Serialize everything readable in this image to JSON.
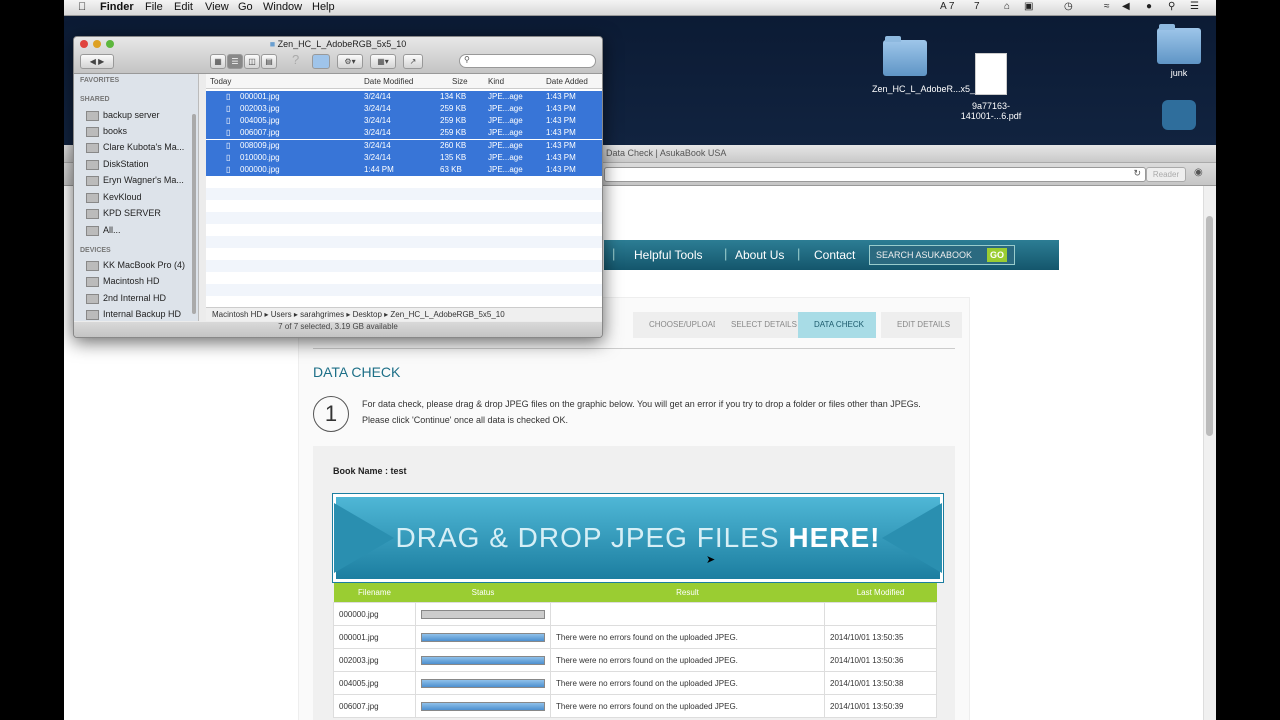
{
  "menubar": {
    "apple": "",
    "app": "Finder",
    "items": [
      "File",
      "Edit",
      "View",
      "Go",
      "Window",
      "Help"
    ],
    "status": [
      "A 7",
      "7"
    ]
  },
  "desktop": {
    "icons": [
      {
        "label": "Zen_HC_L_AdobeR...x5_10",
        "type": "folder-icon"
      },
      {
        "label": "9a77163-141001-...6.pdf",
        "type": "pdf-icon"
      },
      {
        "label": "junk",
        "type": "folder-icon"
      }
    ]
  },
  "browser": {
    "title": "Data Check | AsukaBook USA",
    "reader": "Reader",
    "nav": [
      "Helpful Tools",
      "About Us",
      "Contact"
    ],
    "search_placeholder": "SEARCH  ASUKABOOK",
    "search_go": "GO",
    "steps": [
      "CHOOSE/UPLOAD",
      "SELECT DETAILS",
      "DATA CHECK",
      "EDIT DETAILS"
    ],
    "page_title": "DATA CHECK",
    "step_number": "1",
    "instructions_1": "For data check, please drag & drop JPEG files on the graphic below. You will get an error if you try to drop a folder or files other than JPEGs.",
    "instructions_2": "Please click 'Continue' once all data is checked OK.",
    "book_name_label": "Book Name :",
    "book_name_value": "test",
    "drop_text": "DRAG & DROP JPEG FILES",
    "drop_emphasis": "HERE!",
    "table": {
      "headers": [
        "Filename",
        "Status",
        "Result",
        "Last Modified"
      ],
      "rows": [
        {
          "filename": "000000.jpg",
          "status": "empty",
          "result": "",
          "modified": ""
        },
        {
          "filename": "000001.jpg",
          "status": "full",
          "result": "There were no errors found on the uploaded JPEG.",
          "modified": "2014/10/01 13:50:35"
        },
        {
          "filename": "002003.jpg",
          "status": "full",
          "result": "There were no errors found on the uploaded JPEG.",
          "modified": "2014/10/01 13:50:36"
        },
        {
          "filename": "004005.jpg",
          "status": "full",
          "result": "There were no errors found on the uploaded JPEG.",
          "modified": "2014/10/01 13:50:38"
        },
        {
          "filename": "006007.jpg",
          "status": "full",
          "result": "There were no errors found on the uploaded JPEG.",
          "modified": "2014/10/01 13:50:39"
        }
      ]
    }
  },
  "finder": {
    "title": "Zen_HC_L_AdobeRGB_5x5_10",
    "sidebar": {
      "favorites_header": "FAVORITES",
      "shared_header": "SHARED",
      "shared": [
        "backup server",
        "books",
        "Clare Kubota's Ma...",
        "DiskStation",
        "Eryn Wagner's Ma...",
        "KevKloud",
        "KPD SERVER",
        "All..."
      ],
      "devices_header": "DEVICES",
      "devices": [
        "KK MacBook Pro (4)",
        "Macintosh HD",
        "2nd Internal HD",
        "Internal Backup HD"
      ]
    },
    "columns": [
      "Today",
      "Date Modified",
      "Size",
      "Kind",
      "Date Added"
    ],
    "files": [
      {
        "name": "000001.jpg",
        "modified": "3/24/14",
        "size": "134 KB",
        "kind": "JPE...age",
        "added": "1:43 PM"
      },
      {
        "name": "002003.jpg",
        "modified": "3/24/14",
        "size": "259 KB",
        "kind": "JPE...age",
        "added": "1:43 PM"
      },
      {
        "name": "004005.jpg",
        "modified": "3/24/14",
        "size": "259 KB",
        "kind": "JPE...age",
        "added": "1:43 PM"
      },
      {
        "name": "006007.jpg",
        "modified": "3/24/14",
        "size": "259 KB",
        "kind": "JPE...age",
        "added": "1:43 PM"
      },
      {
        "name": "008009.jpg",
        "modified": "3/24/14",
        "size": "260 KB",
        "kind": "JPE...age",
        "added": "1:43 PM"
      },
      {
        "name": "010000.jpg",
        "modified": "3/24/14",
        "size": "135 KB",
        "kind": "JPE...age",
        "added": "1:43 PM"
      },
      {
        "name": "000000.jpg",
        "modified": "1:44 PM",
        "size": "63 KB",
        "kind": "JPE...age",
        "added": "1:43 PM"
      }
    ],
    "path": [
      "Macintosh HD",
      "Users",
      "sarahgrimes",
      "Desktop",
      "Zen_HC_L_AdobeRGB_5x5_10"
    ],
    "status": "7 of 7 selected, 3.19 GB available"
  }
}
